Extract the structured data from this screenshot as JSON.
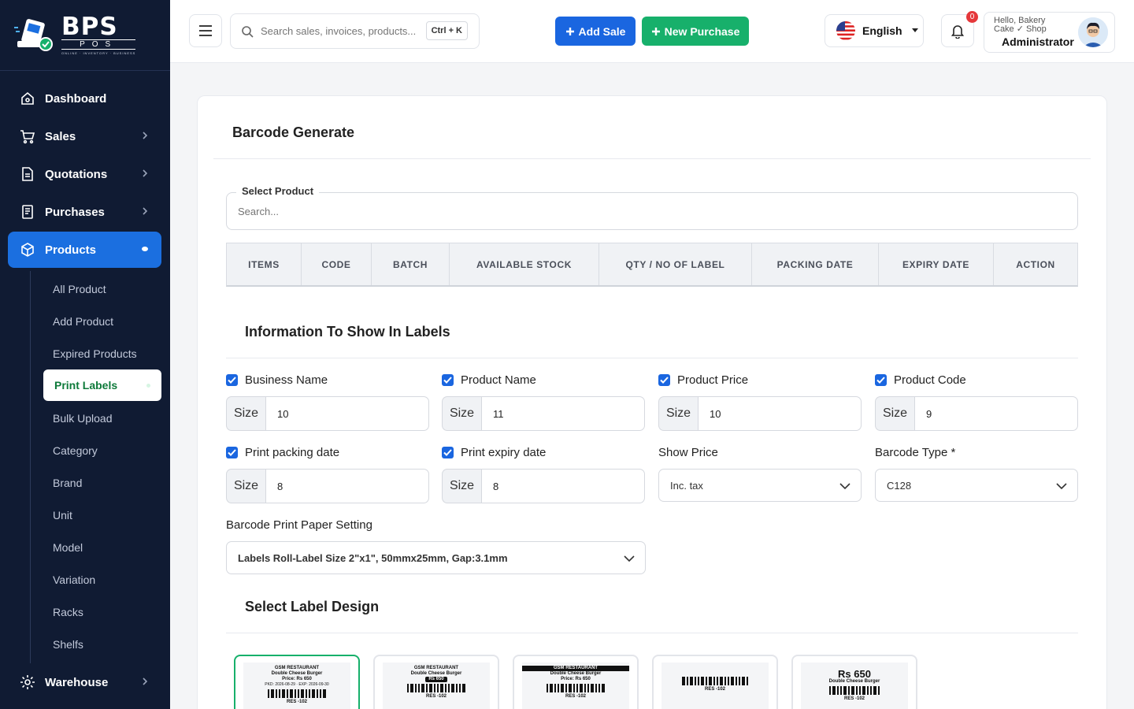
{
  "brand": {
    "name": "BPS",
    "sub": "POS",
    "tagline": "ONLINE · INVENTORY · BUSINESS"
  },
  "sidebar": {
    "items": [
      {
        "label": "Dashboard",
        "icon": "home-icon"
      },
      {
        "label": "Sales",
        "icon": "cart-icon"
      },
      {
        "label": "Quotations",
        "icon": "document-icon"
      },
      {
        "label": "Purchases",
        "icon": "receipt-icon"
      },
      {
        "label": "Products",
        "icon": "box-icon"
      },
      {
        "label": "Warehouse",
        "icon": "gear-icon"
      }
    ],
    "product_sub": [
      "All Product",
      "Add Product",
      "Expired Products",
      "Print Labels",
      "Bulk Upload",
      "Category",
      "Brand",
      "Unit",
      "Model",
      "Variation",
      "Racks",
      "Shelfs"
    ]
  },
  "header": {
    "search_placeholder": "Search sales, invoices, products...",
    "search_shortcut": "Ctrl + K",
    "add_sale": "Add Sale",
    "new_purchase": "New Purchase",
    "language": "English",
    "notifications_count": "0",
    "user_hello": "Hello, Bakery Cake ✓ Shop",
    "user_role": "Administrator"
  },
  "card": {
    "title": "Barcode Generate",
    "select_product_label": "Select Product",
    "select_product_placeholder": "Search...",
    "table_headers": [
      "ITEMS",
      "CODE",
      "BATCH",
      "AVAILABLE STOCK",
      "QTY / NO OF LABEL",
      "PACKING DATE",
      "EXPIRY DATE",
      "ACTION"
    ],
    "info_title": "Information To Show In Labels",
    "size_label": "Size",
    "options": [
      {
        "label": "Business Name",
        "size": "10"
      },
      {
        "label": "Product Name",
        "size": "11"
      },
      {
        "label": "Product Price",
        "size": "10"
      },
      {
        "label": "Product Code",
        "size": "9"
      },
      {
        "label": "Print packing date",
        "size": "8"
      },
      {
        "label": "Print expiry date",
        "size": "8"
      }
    ],
    "show_price_label": "Show Price",
    "show_price_value": "Inc. tax",
    "barcode_type_label": "Barcode Type *",
    "barcode_type_value": "C128",
    "paper_label": "Barcode Print Paper Setting",
    "paper_value": "Labels Roll-Label Size 2\"x1\", 50mmx25mm, Gap:3.1mm",
    "design_title": "Select Label Design",
    "design_preview": {
      "business": "GSM RESTAURANT",
      "product": "Double Cheese Burger",
      "price_line": "Price: Rs 650",
      "price_big": "Rs 650",
      "dates": "PKD: 2026-08-29 · EXP: 2026-09-30",
      "code": "RES -102"
    }
  }
}
